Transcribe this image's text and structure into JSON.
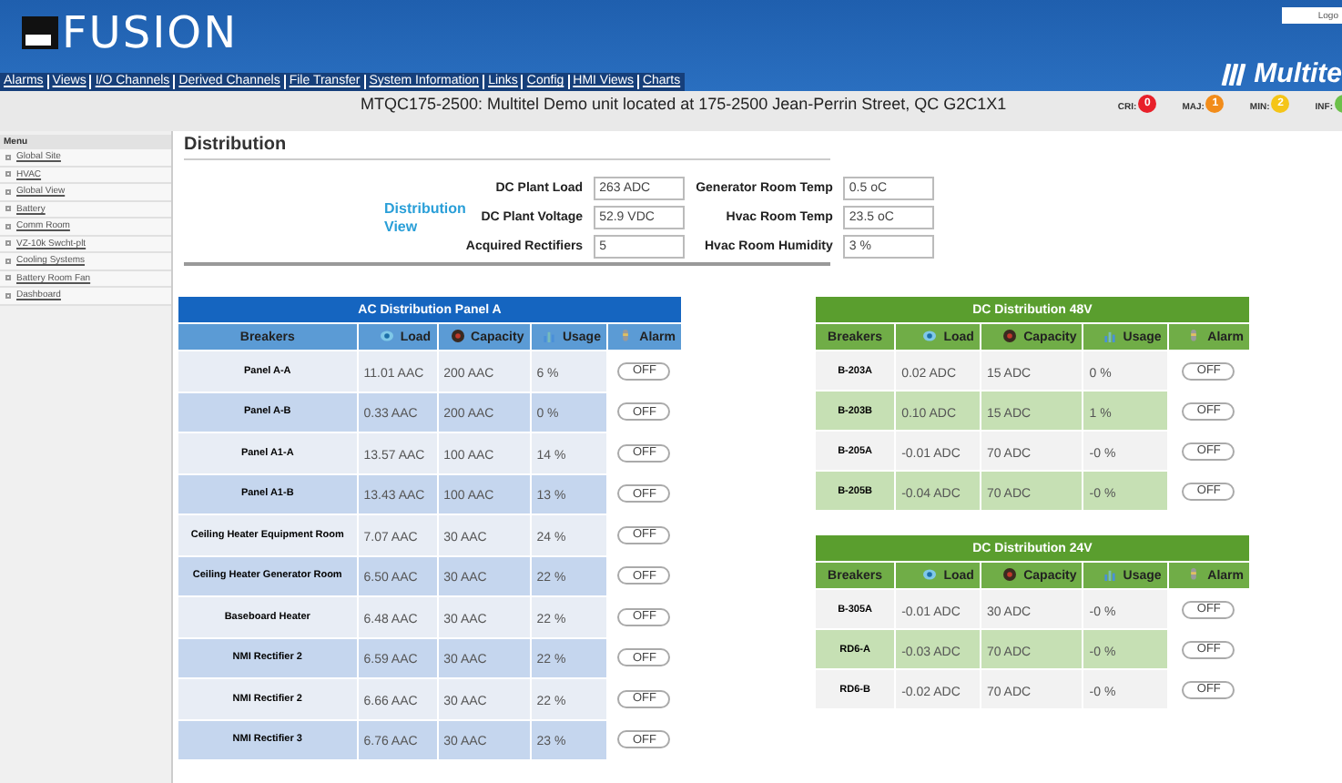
{
  "header": {
    "logo": "FUSION",
    "brand": "Multite",
    "logout": "Logo",
    "nav": [
      "Alarms",
      "Views",
      "I/O Channels",
      "Derived Channels",
      "File Transfer",
      "System Information",
      "Links",
      "Config",
      "HMI Views",
      "Charts"
    ]
  },
  "unit": "MTQC175-2500:   Multitel Demo unit located at 175-2500 Jean-Perrin Street, QC G2C1X1",
  "alarms": [
    {
      "label": "CRI:",
      "count": "0",
      "color": "#e8202a"
    },
    {
      "label": "MAJ:",
      "count": "1",
      "color": "#f28c1a"
    },
    {
      "label": "MIN:",
      "count": "2",
      "color": "#f5c518"
    },
    {
      "label": "INF:",
      "color": "#6cc04a"
    }
  ],
  "sidebar": {
    "title": "Menu",
    "items": [
      "Global Site",
      "HVAC",
      "Global View",
      "Battery",
      "Comm Room",
      "VZ-10k Swcht-plt",
      "Cooling Systems",
      "Battery Room Fan",
      "Dashboard"
    ]
  },
  "page_title": "Distribution",
  "view_label": "Distribution View",
  "readings": [
    {
      "label": "DC Plant Load",
      "value": "263 ADC"
    },
    {
      "label": "Generator Room Temp",
      "value": "0.5 oC"
    },
    {
      "label": "DC Plant Voltage",
      "value": "52.9 VDC"
    },
    {
      "label": "Hvac Room Temp",
      "value": "23.5 oC"
    },
    {
      "label": "Acquired Rectifiers",
      "value": "5"
    },
    {
      "label": "Hvac Room Humidity",
      "value": "3 %"
    }
  ],
  "tables": [
    {
      "title": "AC Distribution Panel A",
      "kind": "ac",
      "columns": [
        "Breakers",
        "Load",
        "Capacity",
        "Usage",
        "Alarm"
      ],
      "rows": [
        {
          "breaker": "Panel  A-A",
          "load": "11.01 AAC",
          "capacity": "200 AAC",
          "usage": "6 %",
          "alarm": "OFF"
        },
        {
          "breaker": "Panel A-B",
          "load": "0.33 AAC",
          "capacity": "200 AAC",
          "usage": "0 %",
          "alarm": "OFF"
        },
        {
          "breaker": "Panel A1-A",
          "load": "13.57 AAC",
          "capacity": "100 AAC",
          "usage": "14 %",
          "alarm": "OFF"
        },
        {
          "breaker": "Panel A1-B",
          "load": "13.43 AAC",
          "capacity": "100 AAC",
          "usage": "13 %",
          "alarm": "OFF"
        },
        {
          "breaker": "Ceiling Heater Equipment Room",
          "load": "7.07 AAC",
          "capacity": "30 AAC",
          "usage": "24 %",
          "alarm": "OFF"
        },
        {
          "breaker": "Ceiling Heater  Generator Room",
          "load": "6.50 AAC",
          "capacity": "30 AAC",
          "usage": "22 %",
          "alarm": "OFF"
        },
        {
          "breaker": "Baseboard Heater",
          "load": "6.48 AAC",
          "capacity": "30 AAC",
          "usage": "22 %",
          "alarm": "OFF"
        },
        {
          "breaker": "NMI Rectifier 2",
          "load": "6.59 AAC",
          "capacity": "30 AAC",
          "usage": "22 %",
          "alarm": "OFF"
        },
        {
          "breaker": "NMI Rectifier 2",
          "load": "6.66 AAC",
          "capacity": "30 AAC",
          "usage": "22 %",
          "alarm": "OFF"
        },
        {
          "breaker": "NMI Rectifier 3",
          "load": "6.76 AAC",
          "capacity": "30 AAC",
          "usage": "23 %",
          "alarm": "OFF"
        }
      ]
    },
    {
      "title": "DC Distribution 48V",
      "kind": "dc",
      "columns": [
        "Breakers",
        "Load",
        "Capacity",
        "Usage",
        "Alarm"
      ],
      "rows": [
        {
          "breaker": "B-203A",
          "load": "0.02 ADC",
          "capacity": "15 ADC",
          "usage": "0 %",
          "alarm": "OFF"
        },
        {
          "breaker": "B-203B",
          "load": "0.10 ADC",
          "capacity": "15 ADC",
          "usage": "1 %",
          "alarm": "OFF"
        },
        {
          "breaker": "B-205A",
          "load": "-0.01 ADC",
          "capacity": "70 ADC",
          "usage": "-0 %",
          "alarm": "OFF"
        },
        {
          "breaker": "B-205B",
          "load": "-0.04 ADC",
          "capacity": "70 ADC",
          "usage": "-0 %",
          "alarm": "OFF"
        }
      ]
    },
    {
      "title": "DC Distribution 24V",
      "kind": "dc",
      "columns": [
        "Breakers",
        "Load",
        "Capacity",
        "Usage",
        "Alarm"
      ],
      "rows": [
        {
          "breaker": "B-305A",
          "load": "-0.01 ADC",
          "capacity": "30 ADC",
          "usage": "-0 %",
          "alarm": "OFF"
        },
        {
          "breaker": "RD6-A",
          "load": "-0.03 ADC",
          "capacity": "70 ADC",
          "usage": "-0 %",
          "alarm": "OFF"
        },
        {
          "breaker": "RD6-B",
          "load": "-0.02 ADC",
          "capacity": "70 ADC",
          "usage": "-0 %",
          "alarm": "OFF"
        }
      ]
    }
  ]
}
